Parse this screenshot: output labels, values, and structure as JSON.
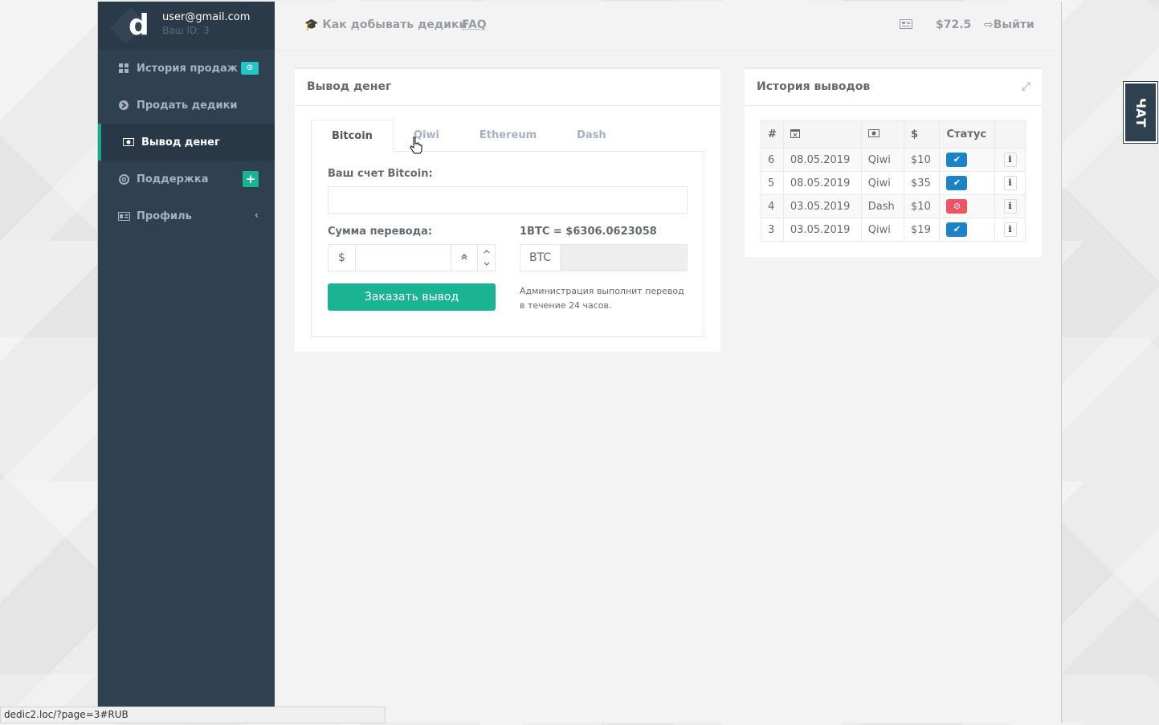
{
  "user": {
    "email": "user@gmail.com",
    "id_label": "Ваш ID: 3",
    "logo_letter": "d"
  },
  "sidebar": {
    "items": [
      {
        "label": "История продаж",
        "icon": "grid-icon",
        "badge": "⊙"
      },
      {
        "label": "Продать дедики",
        "icon": "arrow-circle-icon"
      },
      {
        "label": "Вывод денег",
        "icon": "money-icon",
        "active": true
      },
      {
        "label": "Поддержка",
        "icon": "lifebuoy-icon",
        "badge": "+"
      },
      {
        "label": "Профиль",
        "icon": "id-card-icon",
        "badge": "‹"
      }
    ]
  },
  "topbar": {
    "howto": "Как добывать дедики",
    "faq": "FAQ",
    "balance": "$72.5",
    "logout": "Выйти"
  },
  "withdraw": {
    "title": "Вывод денег",
    "tabs": [
      "Bitcoin",
      "Qiwi",
      "Ethereum",
      "Dash"
    ],
    "active_tab": "Bitcoin",
    "account_label": "Ваш счет Bitcoin:",
    "account_value": "",
    "amount_label": "Сумма перевода:",
    "currency_symbol": "$",
    "amount_value": "",
    "rate_label": "1BTC = $6306.0623058",
    "btc_addon": "BTC",
    "btc_value": "",
    "submit": "Заказать вывод",
    "note": "Администрация выполнит перевод в течение 24 часов."
  },
  "history": {
    "title": "История выводов",
    "headers": [
      "#",
      "",
      "",
      "$",
      "Статус",
      ""
    ],
    "rows": [
      {
        "id": "6",
        "date": "08.05.2019",
        "method": "Qiwi",
        "amount": "$10",
        "status": "ok"
      },
      {
        "id": "5",
        "date": "08.05.2019",
        "method": "Qiwi",
        "amount": "$35",
        "status": "ok"
      },
      {
        "id": "4",
        "date": "03.05.2019",
        "method": "Dash",
        "amount": "$10",
        "status": "rejected"
      },
      {
        "id": "3",
        "date": "03.05.2019",
        "method": "Qiwi",
        "amount": "$19",
        "status": "ok"
      }
    ]
  },
  "chat": {
    "label": "ЧАТ"
  },
  "status_bar": {
    "url": "dedic2.loc/?page=3#RUB"
  },
  "colors": {
    "sidebar": "#2f4050",
    "accent": "#1ab394",
    "ok": "#1c84c6",
    "error": "#ed5565"
  }
}
